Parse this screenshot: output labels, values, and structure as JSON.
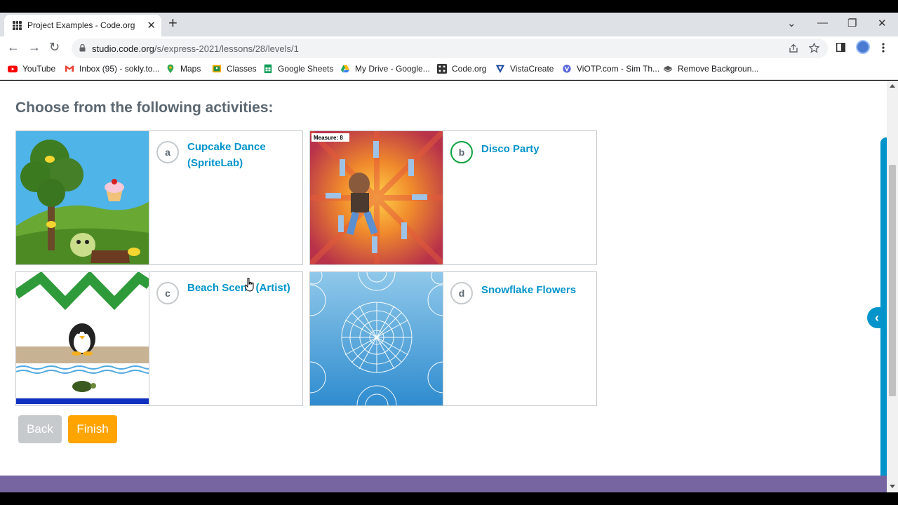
{
  "browser": {
    "tab_title": "Project Examples - Code.org",
    "tab_close": "✕",
    "new_tab": "+",
    "url_host": "studio.code.org",
    "url_path": "/s/express-2021/lessons/28/levels/1",
    "window_controls": {
      "dropdown": "⌄",
      "minimize": "—",
      "restore": "❐",
      "close": "✕"
    },
    "nav": {
      "back": "←",
      "forward": "→",
      "reload": "↻"
    },
    "bookmarks": [
      {
        "label": "YouTube",
        "icon": "youtube-icon"
      },
      {
        "label": "Inbox (95) - sokly.to...",
        "icon": "gmail-icon"
      },
      {
        "label": "Maps",
        "icon": "maps-icon"
      },
      {
        "label": "Classes",
        "icon": "classroom-icon"
      },
      {
        "label": "Google Sheets",
        "icon": "sheets-icon"
      },
      {
        "label": "My Drive - Google...",
        "icon": "drive-icon"
      },
      {
        "label": "Code.org",
        "icon": "codeorg-icon"
      },
      {
        "label": "VistaCreate",
        "icon": "vistacreate-icon"
      },
      {
        "label": "ViOTP.com - Sim Th...",
        "icon": "viotp-icon"
      },
      {
        "label": "Remove Backgroun...",
        "icon": "removebg-icon"
      }
    ]
  },
  "page": {
    "heading": "Choose from the following activities:",
    "activities": [
      {
        "letter": "a",
        "title": "Cupcake Dance (SpriteLab)",
        "selected": false
      },
      {
        "letter": "b",
        "title": "Disco Party",
        "selected": true,
        "thumb_label": "Measure: 8"
      },
      {
        "letter": "c",
        "title": "Beach Scene (Artist)",
        "selected": false
      },
      {
        "letter": "d",
        "title": "Snowflake Flowers",
        "selected": false
      }
    ],
    "back_label": "Back",
    "finish_label": "Finish",
    "side_tab_icon": "‹"
  },
  "colors": {
    "accent": "#0094ca",
    "selected": "#0ea13f",
    "finish": "#ffa400",
    "back_disabled": "#c6cacd",
    "footer": "#7665a0"
  }
}
